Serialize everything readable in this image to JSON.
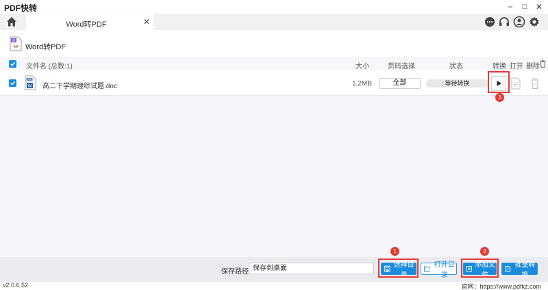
{
  "app": {
    "title": "PDF快转"
  },
  "window": {
    "minimize": "−",
    "maximize": "□",
    "close": "✕"
  },
  "tab": {
    "label": "Word转PDF",
    "close": "✕"
  },
  "toolbar_icons": [
    "home-icon",
    "chat-icon",
    "headset-icon",
    "user-icon",
    "gear-icon"
  ],
  "panel": {
    "title": "Word转PDF"
  },
  "columns": {
    "name": "文件名 (总数:1)",
    "size": "大小",
    "pages": "页码选择",
    "status": "状态",
    "convert": "转换",
    "open": "打开",
    "delete": "删除"
  },
  "files": [
    {
      "name": "高二下学期理综试题.doc",
      "size": "1.2MB",
      "pages": "全部",
      "status": "等待转换",
      "checked": true
    }
  ],
  "annotations": [
    "1",
    "2",
    "3"
  ],
  "bottom": {
    "save_label": "保存路径:",
    "save_value": "保存到桌面",
    "select_dir": "选择目录",
    "open_dir": "打开目录",
    "add_file": "添加文件",
    "batch_convert": "批量转换"
  },
  "status_bar": {
    "version": "v2.0.6.52",
    "website": "官网：https://www.pdfkz.com"
  },
  "colors": {
    "accent": "#1a8cdb",
    "annotation": "#e53935"
  }
}
